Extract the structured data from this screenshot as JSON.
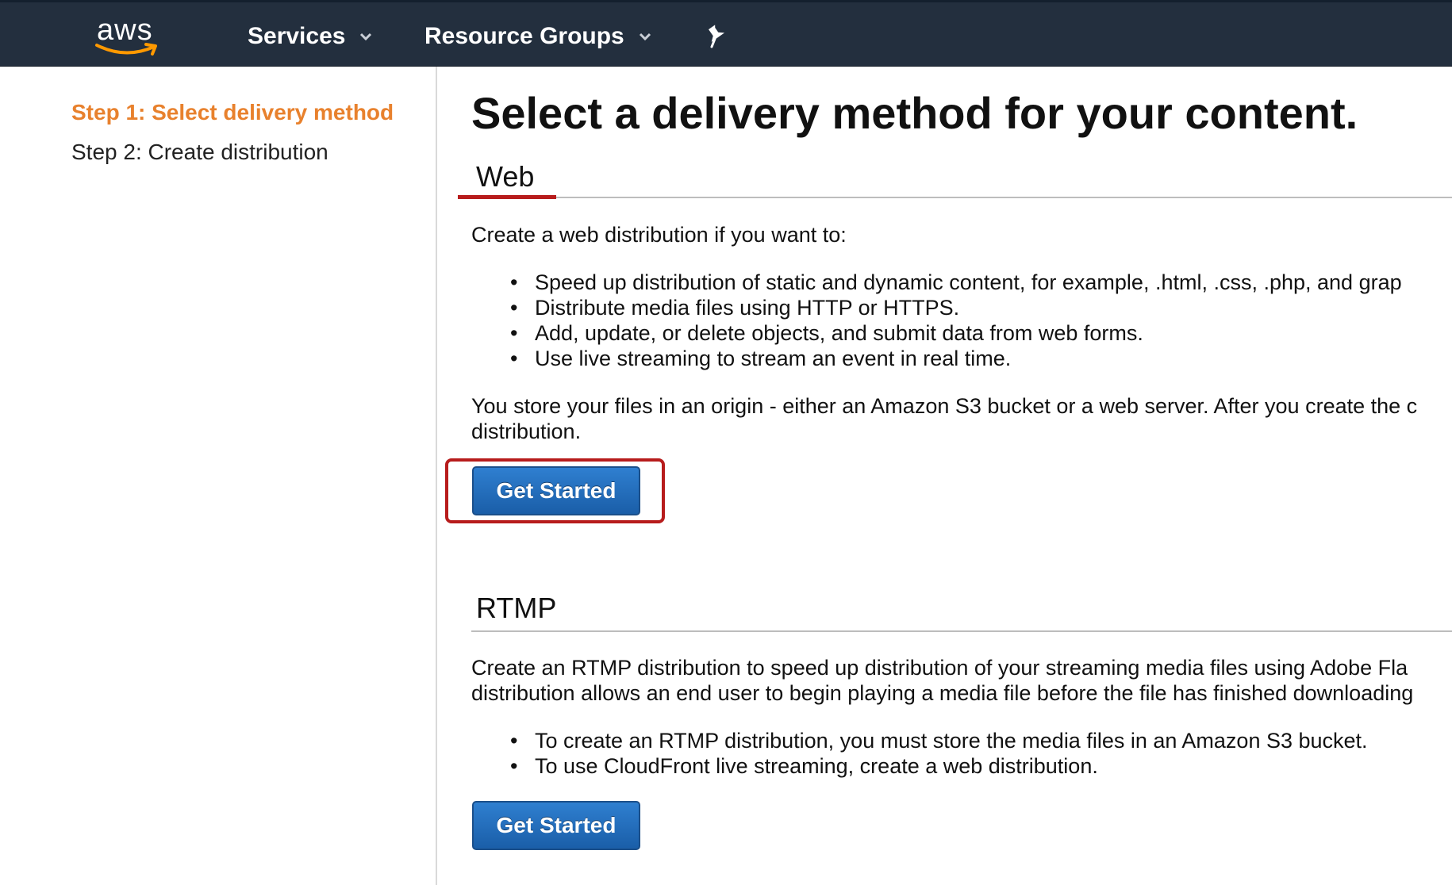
{
  "topbar": {
    "logo_text": "aws",
    "nav": [
      {
        "label": "Services",
        "icon": "chevron-down-icon"
      },
      {
        "label": "Resource Groups",
        "icon": "chevron-down-icon"
      }
    ],
    "pin_icon": "pin-icon"
  },
  "sidebar": {
    "steps": [
      {
        "label": "Step 1: Select delivery method",
        "active": true
      },
      {
        "label": "Step 2: Create distribution",
        "active": false
      }
    ]
  },
  "main": {
    "title": "Select a delivery method for your content.",
    "web": {
      "heading": "Web",
      "intro": "Create a web distribution if you want to:",
      "bullets": [
        "Speed up distribution of static and dynamic content, for example, .html, .css, .php, and grap",
        "Distribute media files using HTTP or HTTPS.",
        "Add, update, or delete objects, and submit data from web forms.",
        "Use live streaming to stream an event in real time."
      ],
      "origin_line1": "You store your files in an origin - either an Amazon S3 bucket or a web server. After you create the c",
      "origin_line2": "distribution.",
      "button": "Get Started"
    },
    "rtmp": {
      "heading": "RTMP",
      "line1": "Create an RTMP distribution to speed up distribution of your streaming media files using Adobe Fla",
      "line2": "distribution allows an end user to begin playing a media file before the file has finished downloading",
      "bullets": [
        "To create an RTMP distribution, you must store the media files in an Amazon S3 bucket.",
        "To use CloudFront live streaming, create a web distribution."
      ],
      "button": "Get Started"
    }
  },
  "colors": {
    "topbar_bg": "#232f3e",
    "active_step": "#e8812d",
    "highlight": "#b71c1c",
    "button": "#1f6bb8",
    "aws_smile": "#ff9900"
  }
}
